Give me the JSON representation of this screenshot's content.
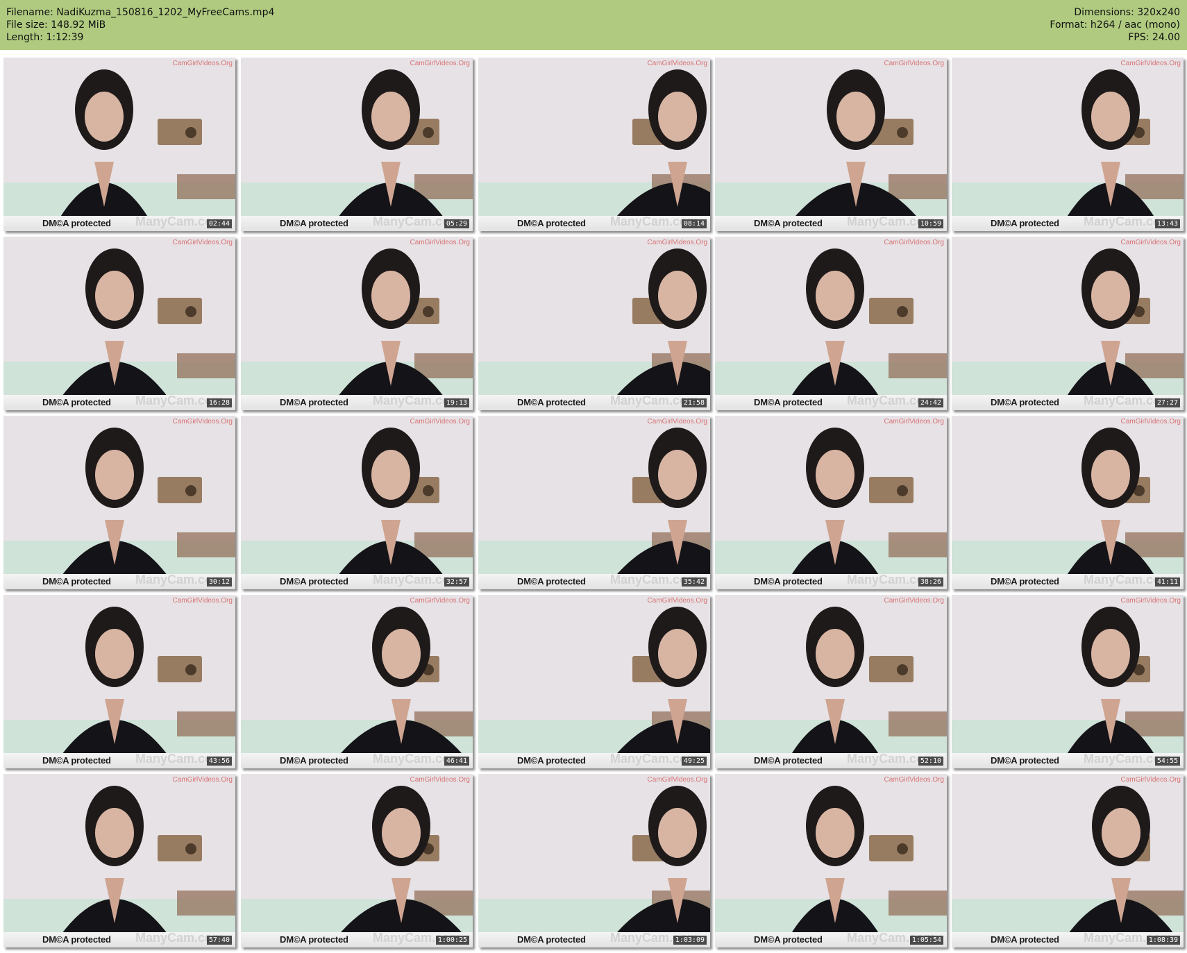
{
  "header": {
    "filename": "Filename: NadiKuzma_150816_1202_MyFreeCams.mp4",
    "file_size": "File size: 148.92 MiB",
    "length": "Length: 1:12:39",
    "dimensions": "Dimensions: 320x240",
    "format": "Format: h264 / aac (mono)",
    "fps": "FPS: 24.00",
    "background_color": "#b0cb80"
  },
  "watermarks": {
    "dmca": "DM©A protected",
    "manycam": "ManyCam.com",
    "site": "CamGirlVideos.Org"
  },
  "thumbnails": [
    {
      "time": "02:44"
    },
    {
      "time": "05:29"
    },
    {
      "time": "08:14"
    },
    {
      "time": "10:59"
    },
    {
      "time": "13:43"
    },
    {
      "time": "16:28"
    },
    {
      "time": "19:13"
    },
    {
      "time": "21:58"
    },
    {
      "time": "24:42"
    },
    {
      "time": "27:27"
    },
    {
      "time": "30:12"
    },
    {
      "time": "32:57"
    },
    {
      "time": "35:42"
    },
    {
      "time": "38:26"
    },
    {
      "time": "41:11"
    },
    {
      "time": "43:56"
    },
    {
      "time": "46:41"
    },
    {
      "time": "49:25"
    },
    {
      "time": "52:10"
    },
    {
      "time": "54:55"
    },
    {
      "time": "57:40"
    },
    {
      "time": "1:00:25"
    },
    {
      "time": "1:03:09"
    },
    {
      "time": "1:05:54"
    },
    {
      "time": "1:08:39"
    }
  ]
}
